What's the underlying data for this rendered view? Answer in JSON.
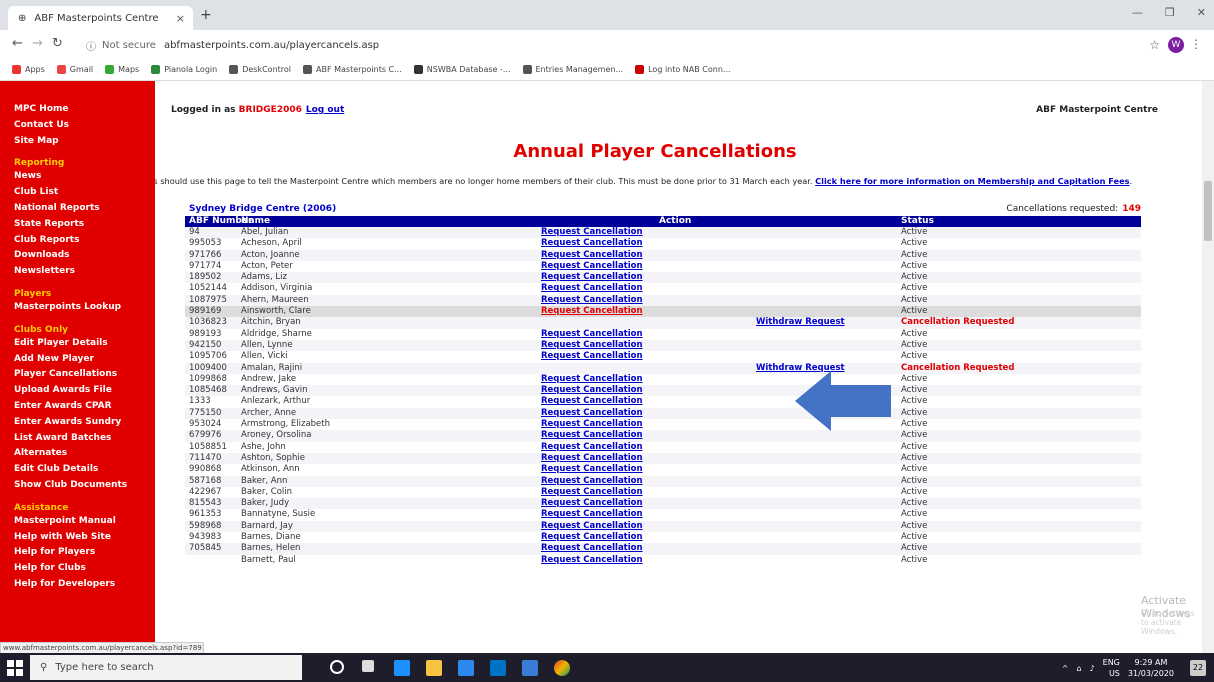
{
  "browser": {
    "tab_title": "ABF Masterpoints Centre",
    "tab_close": "×",
    "new_tab": "+",
    "not_secure": "Not secure",
    "url": "abfmasterpoints.com.au/playercancels.asp",
    "bookmarks": [
      {
        "label": "Apps",
        "color": "#e33"
      },
      {
        "label": "Gmail",
        "color": "#e44"
      },
      {
        "label": "Maps",
        "color": "#3a3"
      },
      {
        "label": "Pianola Login",
        "color": "#2c8a3e"
      },
      {
        "label": "DeskControl",
        "color": "#555"
      },
      {
        "label": "ABF Masterpoints C...",
        "color": "#555"
      },
      {
        "label": "NSWBA Database -...",
        "color": "#333"
      },
      {
        "label": "Entries Managemen...",
        "color": "#555"
      },
      {
        "label": "Log into NAB Conn...",
        "color": "#c00"
      }
    ],
    "profile_initial": "W",
    "status_url": "www.abfmasterpoints.com.au/playercancels.asp?id=7891&reqty"
  },
  "sidebar": {
    "sections": [
      {
        "title": "",
        "items": [
          "MPC Home",
          "Contact Us",
          "Site Map"
        ]
      },
      {
        "title": "Reporting",
        "items": [
          "News",
          "Club List",
          "National Reports",
          "State Reports",
          "Club Reports",
          "Downloads",
          "Newsletters"
        ]
      },
      {
        "title": "Players",
        "items": [
          "Masterpoints Lookup"
        ]
      },
      {
        "title": "Clubs Only",
        "items": [
          "Edit Player Details",
          "Add New Player",
          "Player Cancellations",
          "Upload Awards File",
          "Enter Awards CPAR",
          "Enter Awards Sundry",
          "List Award Batches",
          "Alternates",
          "Edit Club Details",
          "Show Club Documents"
        ]
      },
      {
        "title": "Assistance",
        "items": [
          "Masterpoint Manual",
          "Help with Web Site",
          "Help for Players",
          "Help for Clubs",
          "Help for Developers"
        ]
      }
    ]
  },
  "header": {
    "logged_in_prefix": "Logged in as ",
    "username": "BRIDGE2006",
    "logout": "Log out",
    "site_name": "ABF Masterpoint Centre"
  },
  "page": {
    "title": "Annual Player Cancellations",
    "intro": "Clubs should use this page to tell the Masterpoint Centre which members are no longer home members of their club. This must be done prior to 31 March each year. ",
    "intro_link": "Click here for more information on Membership and Capitation Fees",
    "intro_end": "."
  },
  "table": {
    "club": "Sydney Bridge Centre (2006)",
    "count_label": "Cancellations requested:",
    "count": "149",
    "headers": {
      "abf": "ABF Number",
      "name": "Name",
      "action": "Action",
      "status": "Status"
    },
    "rows": [
      {
        "num": "94",
        "name": "Abel, Julian",
        "req": "Request Cancellation",
        "wd": "",
        "status": "Active"
      },
      {
        "num": "995053",
        "name": "Acheson, April",
        "req": "Request Cancellation",
        "wd": "",
        "status": "Active"
      },
      {
        "num": "971766",
        "name": "Acton, Joanne",
        "req": "Request Cancellation",
        "wd": "",
        "status": "Active"
      },
      {
        "num": "971774",
        "name": "Acton, Peter",
        "req": "Request Cancellation",
        "wd": "",
        "status": "Active"
      },
      {
        "num": "189502",
        "name": "Adams, Liz",
        "req": "Request Cancellation",
        "wd": "",
        "status": "Active"
      },
      {
        "num": "1052144",
        "name": "Addison, Virginia",
        "req": "Request Cancellation",
        "wd": "",
        "status": "Active"
      },
      {
        "num": "1087975",
        "name": "Ahern, Maureen",
        "req": "Request Cancellation",
        "wd": "",
        "status": "Active"
      },
      {
        "num": "989169",
        "name": "Ainsworth, Clare",
        "req": "Request Cancellation",
        "wd": "",
        "status": "Active",
        "hl": true
      },
      {
        "num": "1036823",
        "name": "Aitchin, Bryan",
        "req": "",
        "wd": "Withdraw Request",
        "status": "Cancellation Requested"
      },
      {
        "num": "989193",
        "name": "Aldridge, Sharne",
        "req": "Request Cancellation",
        "wd": "",
        "status": "Active"
      },
      {
        "num": "942150",
        "name": "Allen, Lynne",
        "req": "Request Cancellation",
        "wd": "",
        "status": "Active"
      },
      {
        "num": "1095706",
        "name": "Allen, Vicki",
        "req": "Request Cancellation",
        "wd": "",
        "status": "Active"
      },
      {
        "num": "1009400",
        "name": "Amalan, Rajini",
        "req": "",
        "wd": "Withdraw Request",
        "status": "Cancellation Requested"
      },
      {
        "num": "1099868",
        "name": "Andrew, Jake",
        "req": "Request Cancellation",
        "wd": "",
        "status": "Active"
      },
      {
        "num": "1085468",
        "name": "Andrews, Gavin",
        "req": "Request Cancellation",
        "wd": "",
        "status": "Active"
      },
      {
        "num": "1333",
        "name": "Anlezark, Arthur",
        "req": "Request Cancellation",
        "wd": "",
        "status": "Active"
      },
      {
        "num": "775150",
        "name": "Archer, Anne",
        "req": "Request Cancellation",
        "wd": "",
        "status": "Active"
      },
      {
        "num": "953024",
        "name": "Armstrong, Elizabeth",
        "req": "Request Cancellation",
        "wd": "",
        "status": "Active"
      },
      {
        "num": "679976",
        "name": "Aroney, Orsolina",
        "req": "Request Cancellation",
        "wd": "",
        "status": "Active"
      },
      {
        "num": "1058851",
        "name": "Ashe, John",
        "req": "Request Cancellation",
        "wd": "",
        "status": "Active"
      },
      {
        "num": "711470",
        "name": "Ashton, Sophie",
        "req": "Request Cancellation",
        "wd": "",
        "status": "Active"
      },
      {
        "num": "990868",
        "name": "Atkinson, Ann",
        "req": "Request Cancellation",
        "wd": "",
        "status": "Active"
      },
      {
        "num": "587168",
        "name": "Baker, Ann",
        "req": "Request Cancellation",
        "wd": "",
        "status": "Active"
      },
      {
        "num": "422967",
        "name": "Baker, Colin",
        "req": "Request Cancellation",
        "wd": "",
        "status": "Active"
      },
      {
        "num": "815543",
        "name": "Baker, Judy",
        "req": "Request Cancellation",
        "wd": "",
        "status": "Active"
      },
      {
        "num": "961353",
        "name": "Bannatyne, Susie",
        "req": "Request Cancellation",
        "wd": "",
        "status": "Active"
      },
      {
        "num": "598968",
        "name": "Barnard, Jay",
        "req": "Request Cancellation",
        "wd": "",
        "status": "Active"
      },
      {
        "num": "943983",
        "name": "Barnes, Diane",
        "req": "Request Cancellation",
        "wd": "",
        "status": "Active"
      },
      {
        "num": "705845",
        "name": "Barnes, Helen",
        "req": "Request Cancellation",
        "wd": "",
        "status": "Active"
      },
      {
        "num": "",
        "name": "Barnett, Paul",
        "req": "Request Cancellation",
        "wd": "",
        "status": "Active"
      }
    ]
  },
  "overlay": {
    "watermark_title": "Activate Windows",
    "watermark_sub": "Go to Settings to activate Windows.",
    "arrow_color": "#4472c4"
  },
  "taskbar": {
    "search_placeholder": "Type here to search",
    "lang": "ENG",
    "locale": "US",
    "time": "9:29 AM",
    "date": "31/03/2020",
    "notif_count": "22"
  }
}
